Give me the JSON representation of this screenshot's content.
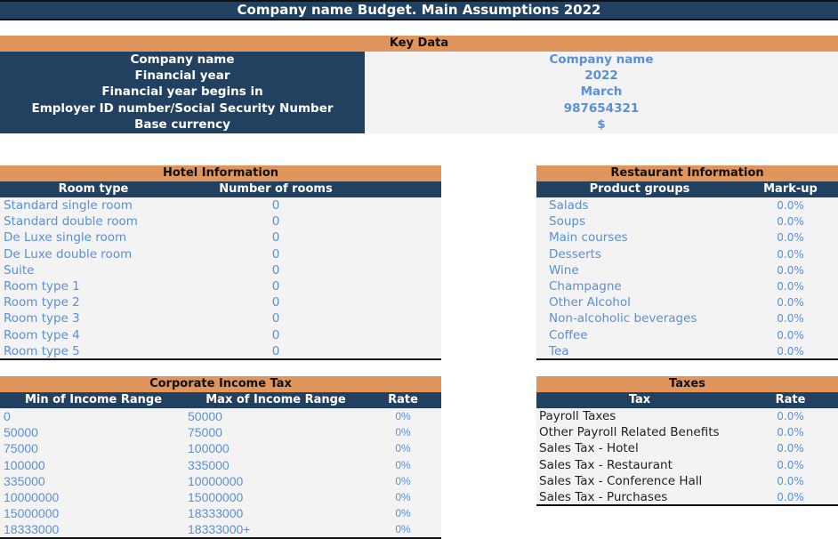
{
  "title": "Company name Budget. Main Assumptions 2022",
  "key_data": {
    "header": "Key Data",
    "rows": [
      {
        "label": "Company name",
        "value": "Company name"
      },
      {
        "label": "Financial year",
        "value": "2022"
      },
      {
        "label": "Financial year begins in",
        "value": "March"
      },
      {
        "label": "Employer ID number/Social Security Number",
        "value": "987654321"
      },
      {
        "label": "Base currency",
        "value": "$"
      }
    ]
  },
  "hotel": {
    "header": "Hotel Information",
    "columns": [
      "Room type",
      "Number of rooms"
    ],
    "rows": [
      {
        "name": "Standard single room",
        "value": "0"
      },
      {
        "name": "Standard double room",
        "value": "0"
      },
      {
        "name": "De Luxe single room",
        "value": "0"
      },
      {
        "name": "De Luxe double room",
        "value": "0"
      },
      {
        "name": "Suite",
        "value": "0"
      },
      {
        "name": "Room type 1",
        "value": "0"
      },
      {
        "name": "Room type 2",
        "value": "0"
      },
      {
        "name": "Room type 3",
        "value": "0"
      },
      {
        "name": "Room type 4",
        "value": "0"
      },
      {
        "name": "Room type 5",
        "value": "0"
      }
    ]
  },
  "restaurant": {
    "header": "Restaurant Information",
    "columns": [
      "Product groups",
      "Mark-up"
    ],
    "rows": [
      {
        "name": "Salads",
        "value": "0.0%"
      },
      {
        "name": "Soups",
        "value": "0.0%"
      },
      {
        "name": "Main courses",
        "value": "0.0%"
      },
      {
        "name": "Desserts",
        "value": "0.0%"
      },
      {
        "name": "Wine",
        "value": "0.0%"
      },
      {
        "name": "Champagne",
        "value": "0.0%"
      },
      {
        "name": "Other Alcohol",
        "value": "0.0%"
      },
      {
        "name": "Non-alcoholic beverages",
        "value": "0.0%"
      },
      {
        "name": "Coffee",
        "value": "0.0%"
      },
      {
        "name": "Tea",
        "value": "0.0%"
      }
    ]
  },
  "corporate_tax": {
    "header": "Corporate Income Tax",
    "columns": [
      "Min of Income Range",
      "Max of Income Range",
      "Rate"
    ],
    "rows": [
      {
        "min": "0",
        "max": "50000",
        "rate": "0%"
      },
      {
        "min": "50000",
        "max": "75000",
        "rate": "0%"
      },
      {
        "min": "75000",
        "max": "100000",
        "rate": "0%"
      },
      {
        "min": "100000",
        "max": "335000",
        "rate": "0%"
      },
      {
        "min": "335000",
        "max": "10000000",
        "rate": "0%"
      },
      {
        "min": "10000000",
        "max": "15000000",
        "rate": "0%"
      },
      {
        "min": "15000000",
        "max": "18333000",
        "rate": "0%"
      },
      {
        "min": "18333000",
        "max": "18333000+",
        "rate": "0%"
      }
    ]
  },
  "taxes": {
    "header": "Taxes",
    "columns": [
      "Tax",
      "Rate"
    ],
    "rows": [
      {
        "name": "Payroll Taxes",
        "value": "0.0%"
      },
      {
        "name": "Other Payroll Related Benefits",
        "value": "0.0%"
      },
      {
        "name": "Sales Tax - Hotel",
        "value": "0.0%"
      },
      {
        "name": "Sales Tax - Restaurant",
        "value": "0.0%"
      },
      {
        "name": "Sales Tax - Conference Hall",
        "value": "0.0%"
      },
      {
        "name": "Sales Tax - Purchases",
        "value": "0.0%"
      }
    ]
  }
}
